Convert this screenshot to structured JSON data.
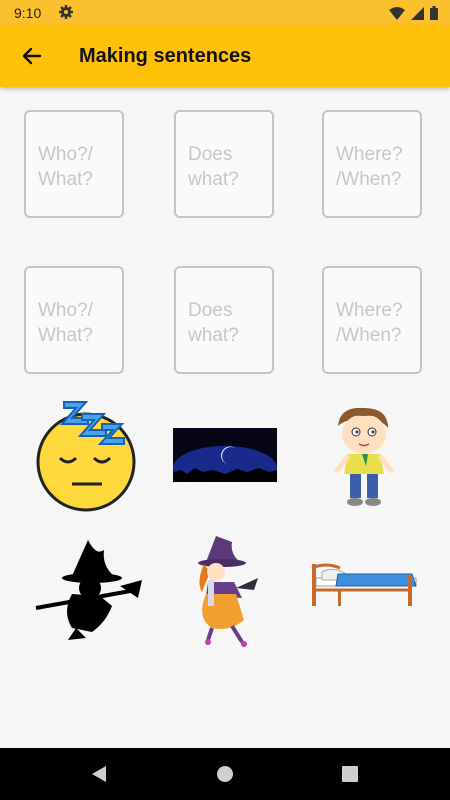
{
  "status_bar": {
    "time": "9:10",
    "settings_icon": "gear-icon",
    "wifi_icon": "wifi-icon",
    "signal_icon": "signal-icon",
    "battery_icon": "battery-icon"
  },
  "app_bar": {
    "title": "Making sentences",
    "back_icon": "arrow-back-icon",
    "color": "#ffc107"
  },
  "sentence_rows": [
    [
      {
        "placeholder": "Who?/\nWhat?"
      },
      {
        "placeholder": "Does\nwhat?"
      },
      {
        "placeholder": "Where?\n/When?"
      }
    ],
    [
      {
        "placeholder": "Who?/\nWhat?"
      },
      {
        "placeholder": "Does\nwhat?"
      },
      {
        "placeholder": "Where?\n/When?"
      }
    ]
  ],
  "picture_cards": [
    {
      "icon": "sleeping-face-icon"
    },
    {
      "icon": "night-moon-icon"
    },
    {
      "icon": "boy-icon"
    },
    {
      "icon": "witch-silhouette-icon"
    },
    {
      "icon": "witch-icon"
    },
    {
      "icon": "bed-icon"
    }
  ],
  "nav_bar": {
    "back": "triangle-back-icon",
    "home": "circle-home-icon",
    "recents": "square-recents-icon"
  }
}
